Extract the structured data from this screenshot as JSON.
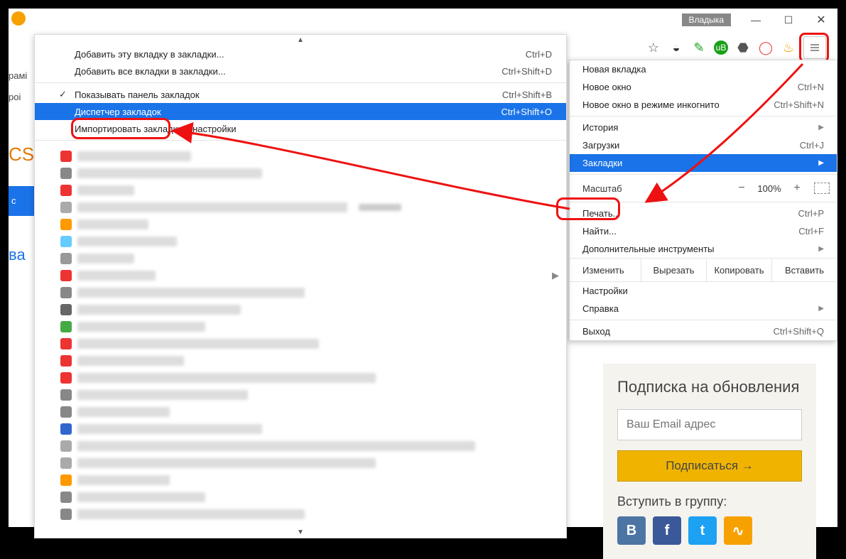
{
  "window": {
    "user_tag": "Владыка",
    "min_tip": "Свернуть",
    "max_tip": "Развернуть",
    "close_tip": "Закрыть"
  },
  "toolbar_icons": [
    "star",
    "pocket",
    "evernote",
    "ublock",
    "adguard",
    "opera",
    "vpn",
    "menu"
  ],
  "main_menu": {
    "new_tab": "Новая вкладка",
    "new_window": "Новое окно",
    "new_window_sc": "Ctrl+N",
    "incognito": "Новое окно в режиме инкогнито",
    "incognito_sc": "Ctrl+Shift+N",
    "history": "История",
    "downloads": "Загрузки",
    "downloads_sc": "Ctrl+J",
    "bookmarks": "Закладки",
    "zoom_label": "Масштаб",
    "zoom_value": "100%",
    "print": "Печать...",
    "print_sc": "Ctrl+P",
    "find": "Найти...",
    "find_sc": "Ctrl+F",
    "more_tools": "Дополнительные инструменты",
    "edit": "Изменить",
    "cut": "Вырезать",
    "copy": "Копировать",
    "paste": "Вставить",
    "settings": "Настройки",
    "help": "Справка",
    "exit": "Выход",
    "exit_sc": "Ctrl+Shift+Q"
  },
  "bookmarks_menu": {
    "add_tab": "Добавить эту вкладку в закладки...",
    "add_tab_sc": "Ctrl+D",
    "add_all": "Добавить все вкладки в закладки...",
    "add_all_sc": "Ctrl+Shift+D",
    "show_bar": "Показывать панель закладок",
    "show_bar_sc": "Ctrl+Shift+B",
    "manager": "Диспетчер закладок",
    "manager_sc": "Ctrl+Shift+O",
    "import": "Импортировать закладки и настройки"
  },
  "left_peek": {
    "l1": "рамі",
    "l2": "роі",
    "l3": "CS",
    "l4": "с",
    "l5": "ва"
  },
  "subscribe": {
    "title": "Подписка на обновления",
    "placeholder": "Ваш Email адрес",
    "button": "Подписаться →",
    "join": "Вступить в группу:"
  }
}
